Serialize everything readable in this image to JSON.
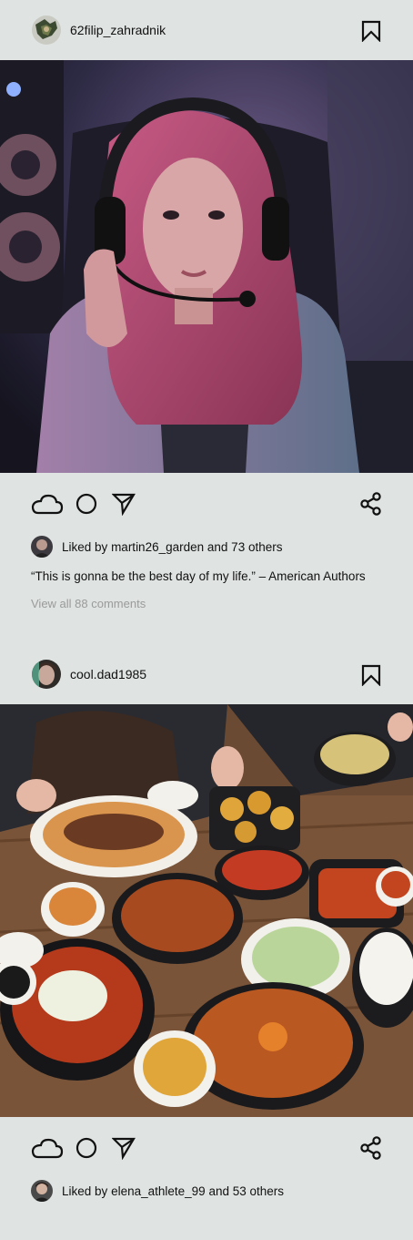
{
  "posts": [
    {
      "username": "62filip_zahradnik",
      "liked_by_user": "martin26_garden",
      "likes_prefix": "Liked by",
      "likes_suffix": "and 73 others",
      "caption": "“This is gonna be the best day of my life.” – American Authors",
      "view_comments": "View all 88 comments",
      "photo_desc_icon": "photo-gamer-headphones"
    },
    {
      "username": "cool.dad1985",
      "liked_by_user": "elena_athlete_99",
      "likes_prefix": "Liked by",
      "likes_suffix": "and 53 others",
      "photo_desc_icon": "photo-korean-food-table"
    }
  ],
  "icons": {
    "like": "cloud-icon",
    "comment": "circle-icon",
    "send": "send-icon",
    "share": "share-icon",
    "bookmark": "bookmark-icon"
  },
  "colors": {
    "background": "#dfe3e2",
    "text": "#111111",
    "muted": "#9a9a9a"
  }
}
